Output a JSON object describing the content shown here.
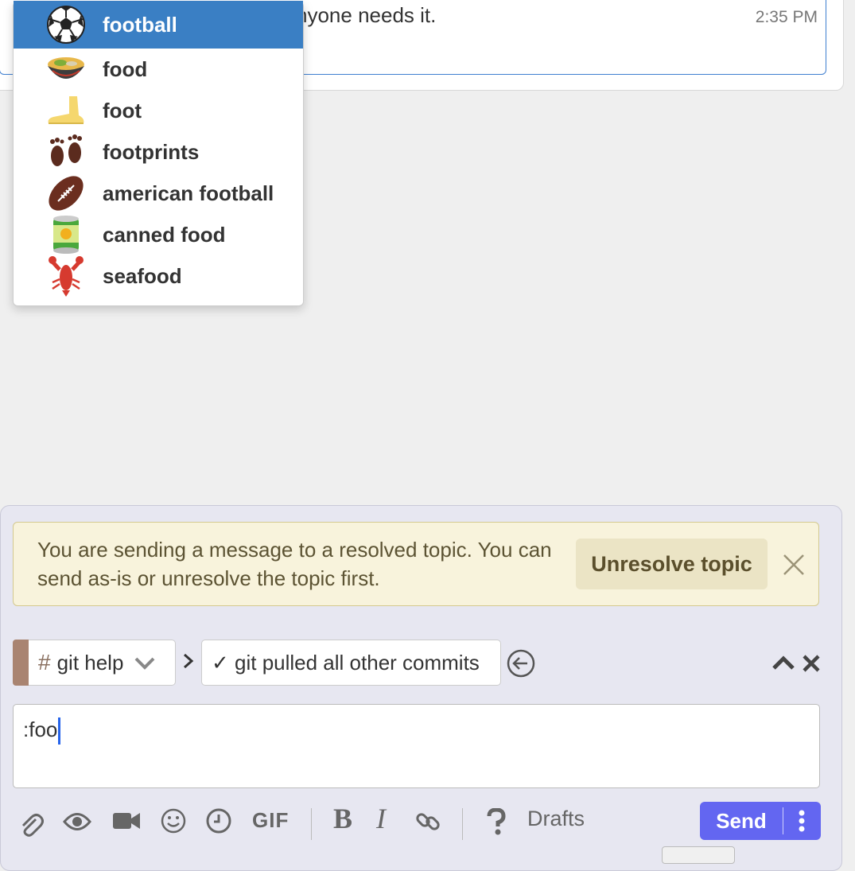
{
  "message": {
    "text": "nyone needs it.",
    "time": "2:35 PM"
  },
  "typeahead": {
    "items": [
      {
        "label": "football",
        "icon": "soccer-ball-icon"
      },
      {
        "label": "food",
        "icon": "bowl-icon"
      },
      {
        "label": "foot",
        "icon": "foot-icon"
      },
      {
        "label": "footprints",
        "icon": "footprints-icon"
      },
      {
        "label": "american football",
        "icon": "american-football-icon"
      },
      {
        "label": "canned food",
        "icon": "canned-food-icon"
      },
      {
        "label": "seafood",
        "icon": "lobster-icon"
      }
    ],
    "active_index": 0,
    "active_color": "#3a7fc4"
  },
  "banner": {
    "text": "You are sending a message to a resolved topic. You can send as-is or unresolve the topic first.",
    "button_label": "Unresolve topic"
  },
  "compose": {
    "stream": "git help",
    "stream_color": "#a98471",
    "topic": "✓ git pulled all other commits",
    "content": ":foo",
    "drafts_label": "Drafts",
    "gif_label": "GIF",
    "send_label": "Send",
    "send_color": "#6366f1"
  }
}
